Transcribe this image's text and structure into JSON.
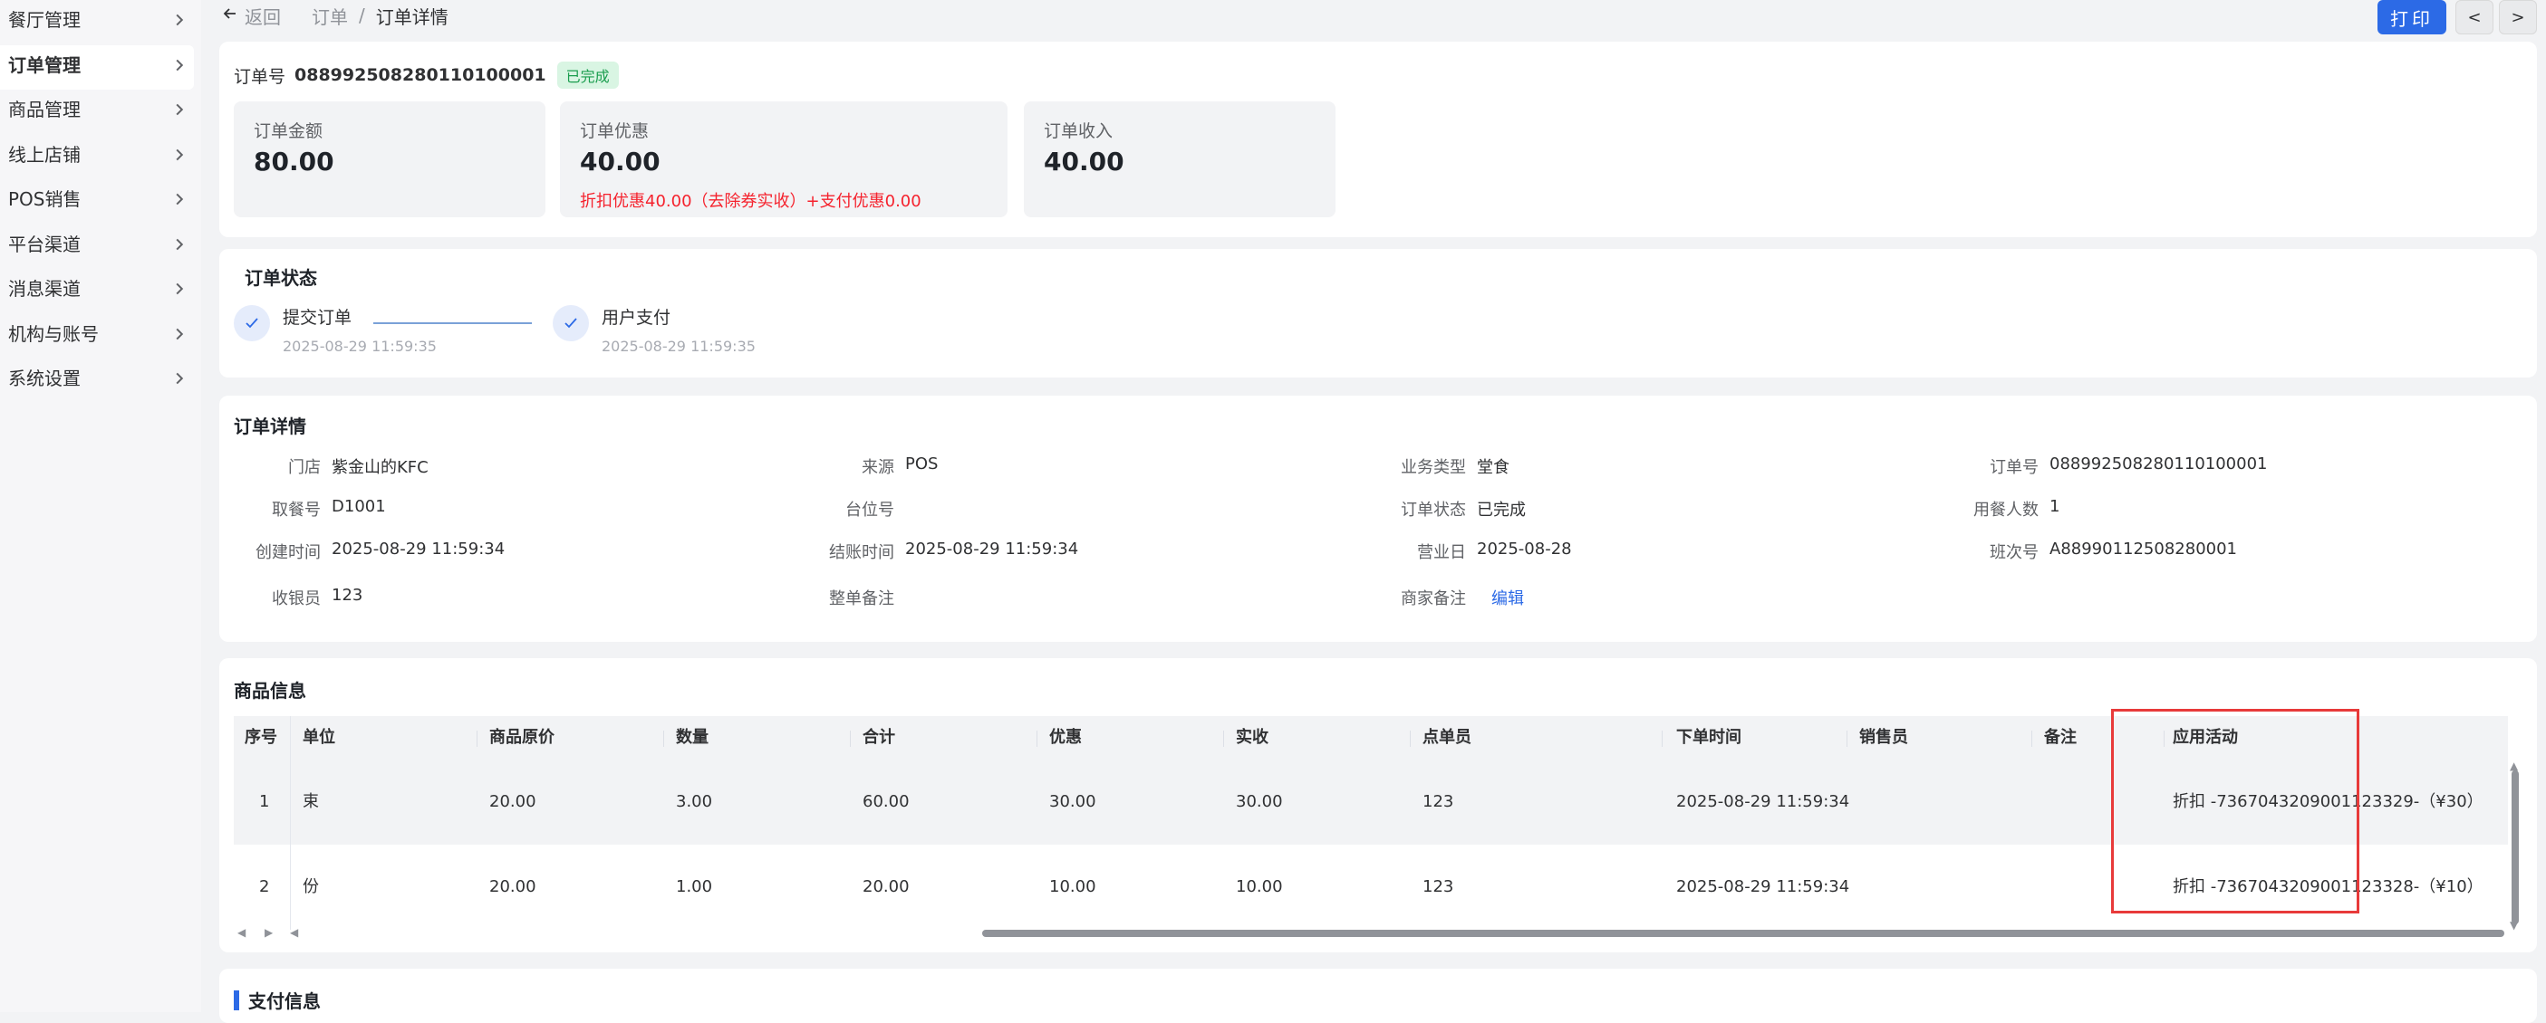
{
  "sidebar": {
    "items": [
      {
        "label": "餐厅管理",
        "active": false
      },
      {
        "label": "订单管理",
        "active": true
      },
      {
        "label": "商品管理",
        "active": false
      },
      {
        "label": "线上店铺",
        "active": false
      },
      {
        "label": "POS销售",
        "active": false
      },
      {
        "label": "平台渠道",
        "active": false
      },
      {
        "label": "消息渠道",
        "active": false
      },
      {
        "label": "机构与账号",
        "active": false
      },
      {
        "label": "系统设置",
        "active": false
      }
    ]
  },
  "topbar": {
    "back_label": "返回",
    "breadcrumb": {
      "root": "订单",
      "sep": "/",
      "current": "订单详情"
    },
    "print_label": "打印",
    "prev_label": "<",
    "next_label": ">"
  },
  "order": {
    "no_label": "订单号",
    "no_value": "088992508280110100001",
    "status_badge": "已完成",
    "stats": [
      {
        "title": "订单金额",
        "value": "80.00"
      },
      {
        "title": "订单优惠",
        "value": "40.00",
        "note": "折扣优惠40.00（去除券实收）+支付优惠0.00"
      },
      {
        "title": "订单收入",
        "value": "40.00"
      }
    ]
  },
  "status": {
    "title": "订单状态",
    "steps": [
      {
        "name": "提交订单",
        "time": "2025-08-29 11:59:35"
      },
      {
        "name": "用户支付",
        "time": "2025-08-29 11:59:35"
      }
    ]
  },
  "detail": {
    "title": "订单详情",
    "rows": [
      [
        {
          "k": "门店",
          "v": "紫金山的KFC"
        },
        {
          "k": "来源",
          "v": "POS"
        },
        {
          "k": "业务类型",
          "v": "堂食"
        },
        {
          "k": "订单号",
          "v": "088992508280110100001"
        }
      ],
      [
        {
          "k": "取餐号",
          "v": "D1001"
        },
        {
          "k": "台位号",
          "v": ""
        },
        {
          "k": "订单状态",
          "v": "已完成"
        },
        {
          "k": "用餐人数",
          "v": "1"
        }
      ],
      [
        {
          "k": "创建时间",
          "v": "2025-08-29 11:59:34"
        },
        {
          "k": "结账时间",
          "v": "2025-08-29 11:59:34"
        },
        {
          "k": "营业日",
          "v": "2025-08-28"
        },
        {
          "k": "班次号",
          "v": "A88990112508280001"
        }
      ],
      [
        {
          "k": "收银员",
          "v": "123"
        },
        {
          "k": "整单备注",
          "v": ""
        },
        {
          "k": "商家备注",
          "v": "编辑"
        },
        {
          "k": "",
          "v": ""
        }
      ]
    ]
  },
  "goods": {
    "title": "商品信息",
    "columns": [
      "序号",
      "单位",
      "商品原价",
      "数量",
      "合计",
      "优惠",
      "实收",
      "点单员",
      "下单时间",
      "销售员",
      "备注",
      "应用活动"
    ],
    "rows": [
      [
        "1",
        "束",
        "20.00",
        "3.00",
        "60.00",
        "30.00",
        "30.00",
        "123",
        "2025-08-29 11:59:34",
        "",
        "",
        "折扣 -7367043209001123329-（¥30）"
      ],
      [
        "2",
        "份",
        "20.00",
        "1.00",
        "20.00",
        "10.00",
        "10.00",
        "123",
        "2025-08-29 11:59:34",
        "",
        "",
        "折扣 -7367043209001123328-（¥10）"
      ]
    ]
  },
  "payment": {
    "title": "支付信息"
  }
}
